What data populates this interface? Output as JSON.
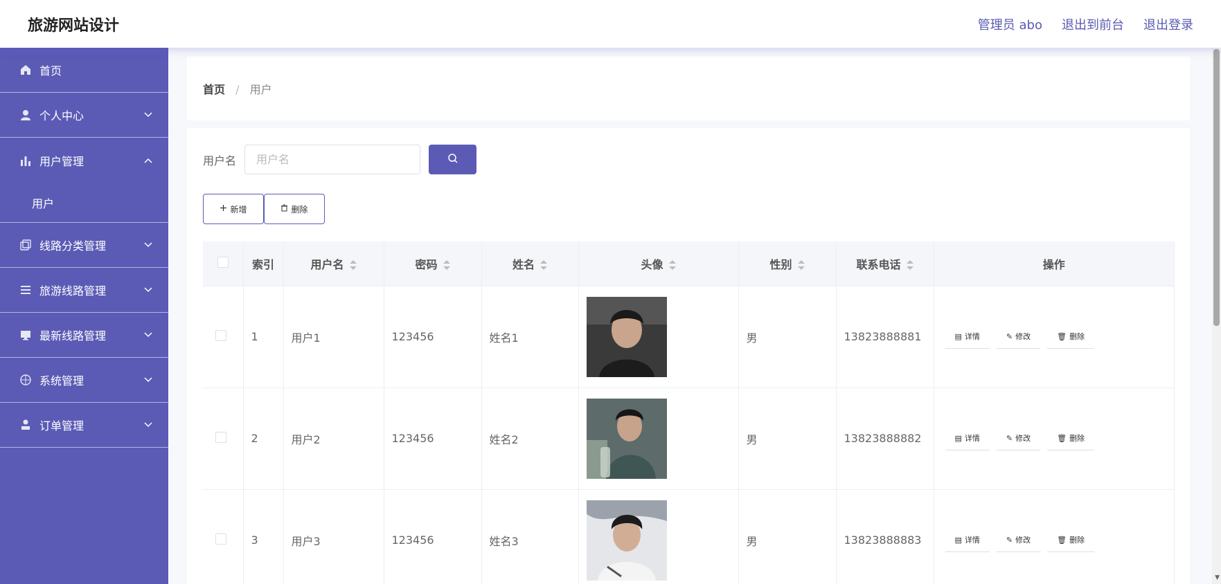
{
  "header": {
    "brand": "旅游网站设计",
    "links": [
      "管理员 abo",
      "退出到前台",
      "退出登录"
    ]
  },
  "sidebar": {
    "items": [
      {
        "label": "首页",
        "icon": "home-icon"
      },
      {
        "label": "个人中心",
        "icon": "user-icon"
      },
      {
        "label": "用户管理",
        "icon": "bar-chart-icon",
        "expanded": true,
        "children": [
          "用户"
        ]
      },
      {
        "label": "线路分类管理",
        "icon": "copy-icon"
      },
      {
        "label": "旅游线路管理",
        "icon": "list-icon"
      },
      {
        "label": "最新线路管理",
        "icon": "monitor-icon"
      },
      {
        "label": "系统管理",
        "icon": "compass-icon"
      },
      {
        "label": "订单管理",
        "icon": "user-solid-icon"
      }
    ]
  },
  "breadcrumb": {
    "home": "首页",
    "sep": "/",
    "current": "用户"
  },
  "search": {
    "label": "用户名",
    "placeholder": "用户名"
  },
  "actions": {
    "add": "新增",
    "delete": "删除"
  },
  "table": {
    "headers": [
      "索引",
      "用户名",
      "密码",
      "姓名",
      "头像",
      "性别",
      "联系电话",
      "操作"
    ],
    "rows": [
      {
        "index": "1",
        "username": "用户1",
        "password": "123456",
        "name": "姓名1",
        "gender": "男",
        "phone": "13823888881"
      },
      {
        "index": "2",
        "username": "用户2",
        "password": "123456",
        "name": "姓名2",
        "gender": "男",
        "phone": "13823888882"
      },
      {
        "index": "3",
        "username": "用户3",
        "password": "123456",
        "name": "姓名3",
        "gender": "男",
        "phone": "13823888883"
      }
    ],
    "ops": {
      "detail": "详情",
      "edit": "修改",
      "delete": "删除"
    }
  },
  "colors": {
    "accent": "#5b5bb6",
    "sidebar": "#5b5bb6"
  }
}
